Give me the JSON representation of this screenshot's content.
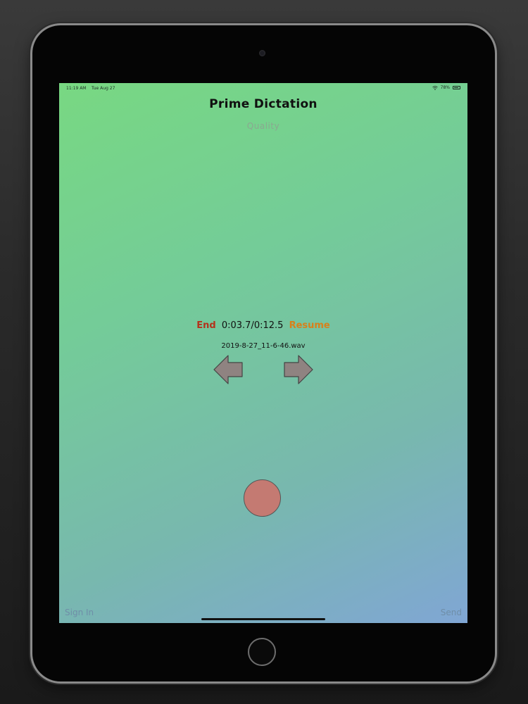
{
  "status_bar": {
    "time": "11:19 AM",
    "date": "Tue Aug 27",
    "battery": "78%"
  },
  "app": {
    "title": "Prime Dictation",
    "quality_label": "Quality"
  },
  "playback": {
    "end_label": "End",
    "time_display": "0:03.7/0:12.5",
    "resume_label": "Resume",
    "filename": "2019-8-27_11-6-46.wav"
  },
  "footer": {
    "sign_in_label": "Sign In",
    "send_label": "Send"
  },
  "colors": {
    "end": "#b4321c",
    "resume": "#d9801a",
    "record": "#c47a72",
    "arrow": "#8f8381"
  }
}
